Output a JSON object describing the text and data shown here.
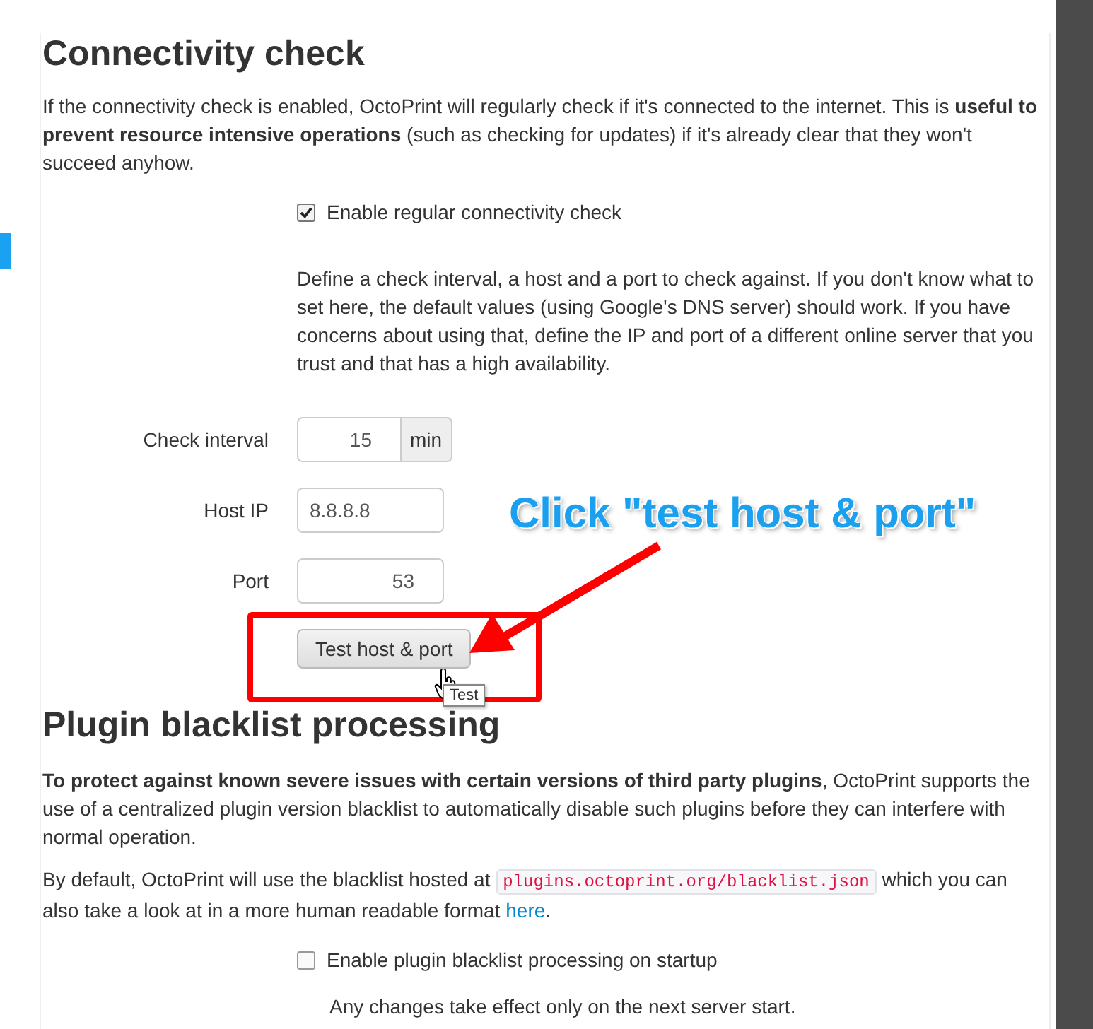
{
  "connectivity": {
    "title": "Connectivity check",
    "intro": "If the connectivity check is enabled, OctoPrint will regularly check if it's connected to the internet. This is **useful to prevent resource intensive operations** (such as checking for updates) if it's already clear that they won't succeed anyhow.",
    "enable": {
      "label": "Enable regular connectivity check",
      "checked": true
    },
    "help": "Define a check interval, a host and a port to check against. If you don't know what to set here, the default values (using Google's DNS server) should work. If you have concerns about using that, define the IP and port of a different online server that you trust and that has a high availability.",
    "fields": [
      {
        "label": "Check interval",
        "value": "15",
        "unit": "min",
        "kind": "number"
      },
      {
        "label": "Host IP",
        "value": "8.8.8.8",
        "kind": "text"
      },
      {
        "label": "Port",
        "value": "53",
        "kind": "number"
      }
    ],
    "test_button": "Test host & port",
    "tooltip": "Test"
  },
  "blacklist": {
    "title": "Plugin blacklist processing",
    "intro": "**To protect against known severe issues with certain versions of third party plugins**, OctoPrint supports the use of a centralized plugin version blacklist to automatically disable such plugins before they can interfere with normal operation.",
    "source_before": "By default, OctoPrint will use the blacklist hosted at",
    "source_code": "plugins.octoprint.org/blacklist.json",
    "source_middle": "which you can also take a look at in a more human readable format",
    "source_link": "here",
    "source_after": ".",
    "enable": {
      "label": "Enable plugin blacklist processing on startup",
      "checked": false
    },
    "note": "Any changes take effect only on the next server start."
  },
  "annotation": {
    "callout": "Click \"test host & port\""
  }
}
